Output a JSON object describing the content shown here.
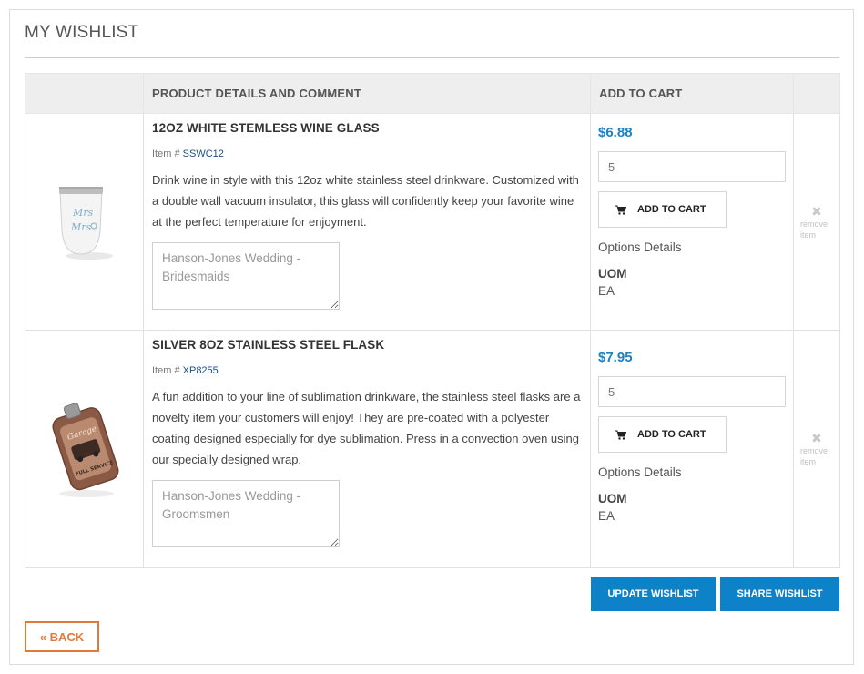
{
  "page": {
    "title": "MY WISHLIST"
  },
  "table": {
    "headers": {
      "product": "PRODUCT DETAILS AND COMMENT",
      "cart": "ADD TO CART"
    }
  },
  "items": [
    {
      "name": "12OZ WHITE STEMLESS WINE GLASS",
      "item_prefix": "Item #",
      "item_number": "SSWC12",
      "description": "Drink wine in style with this 12oz white stainless steel drinkware. Customized with a double wall vacuum insulator, this glass will confidently keep your favorite wine at the perfect temperature for enjoyment.",
      "comment": "Hanson-Jones Wedding - Bridesmaids",
      "image_text_1": "Mrs",
      "image_text_2": "Mrs",
      "price": "$6.88",
      "quantity": "5",
      "add_to_cart_label": "ADD TO CART",
      "options_label": "Options Details",
      "uom_label": "UOM",
      "uom_value": "EA",
      "remove_label": "remove item"
    },
    {
      "name": "SILVER 8OZ STAINLESS STEEL FLASK",
      "item_prefix": "Item #",
      "item_number": "XP8255",
      "description": "A fun addition to your line of sublimation drinkware, the stainless steel flasks are a novelty item your customers will enjoy! They are pre-coated with a polyester coating designed especially for dye sublimation. Press in a convection oven using our specially designed wrap.",
      "comment": "Hanson-Jones Wedding - Groomsmen",
      "image_text_1": "Garage",
      "image_text_2": "FULL SERVICE",
      "price": "$7.95",
      "quantity": "5",
      "add_to_cart_label": "ADD TO CART",
      "options_label": "Options Details",
      "uom_label": "UOM",
      "uom_value": "EA",
      "remove_label": "remove item"
    }
  ],
  "actions": {
    "update": "UPDATE WISHLIST",
    "share": "SHARE WISHLIST",
    "back": "« BACK"
  },
  "colors": {
    "accent_blue": "#0e82c8",
    "price_blue": "#1b82c4",
    "back_orange": "#e07a3a"
  }
}
